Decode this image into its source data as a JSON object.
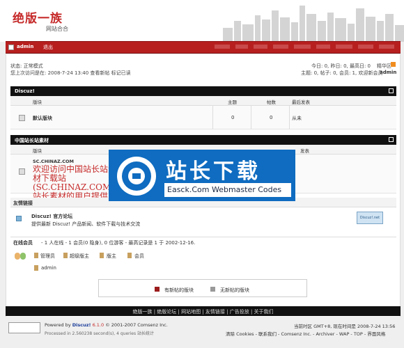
{
  "header": {
    "logo_title": "绝版一族",
    "logo_subtitle": "网站合合"
  },
  "navbar": {
    "username": "admin",
    "logout": "退出",
    "links": [
      "",
      "",
      "",
      "",
      "",
      "",
      "",
      ""
    ]
  },
  "status": {
    "mode": "状态: 正常模式",
    "last_visit": "您上次访问是在: 2008-7-24 13:40 查看新帖 标记已读",
    "today_stats": "今日: 0, 昨日: 0, 最高日: 0",
    "digest": "精华区",
    "topic_stats": "主题: 0, 帖子: 0, 会员: 1, 欢迎新会员",
    "new_member": "admin"
  },
  "section1": {
    "title": "Discuz!",
    "headers": [
      "版块",
      "主题",
      "帖数",
      "最后发表"
    ],
    "rows": [
      {
        "name": "默认版块",
        "topics": "0",
        "posts": "0",
        "last": "从未"
      }
    ]
  },
  "section2": {
    "title": "中国站长站素材",
    "headers": [
      "版块",
      "发表"
    ],
    "rows": [
      {
        "name": "SC.CHINAZ.COM",
        "desc": "欢迎访问中国站长站素材下载站(SC.CHINAZ.COM) 站长素材的用户提供"
      }
    ]
  },
  "friend_links": {
    "title": "友情链接",
    "site_name": "Discuz! 官方论坛",
    "site_desc": "提供最新 Discuz! 产品新闻、软件下载与技术交流",
    "badge": "Discuz!.net"
  },
  "online": {
    "title": "在线会员",
    "summary": "- 1 人在线 - 1 会员(0 隐身), 0 位游客 - 最高记录是 1 于 2002-12-16.",
    "legend": [
      "管理员",
      "超级版主",
      "版主",
      "会员"
    ],
    "users": [
      "admin"
    ]
  },
  "legend_box": {
    "new": "有新帖的版块",
    "nonew": "无新帖的版块"
  },
  "watermark": {
    "title": "站长下载",
    "subtitle": "Easck.Com Webmaster Codes"
  },
  "footer_links": [
    "绝版一族",
    "绝版论坛",
    "网站地图",
    "友情链接",
    "广告投放",
    "关于我们"
  ],
  "bottom": {
    "powered": "Powered by",
    "brand": "Discuz!",
    "version": "6.1.0",
    "copyright": "© 2001-2007 Comsenz Inc.",
    "processed": "Processed in 2.560238 second(s), 4 queries 站长统计",
    "time": "当前时区 GMT+8, 现在时间是 2008-7-24 13:56",
    "links": "清除 Cookies - 联系我们 - Comsenz Inc. - Archiver - WAP - TOP - 界面风格"
  },
  "colors": {
    "accent": "#b71f1f",
    "dark": "#111111",
    "watermark": "#0f6cc0"
  }
}
